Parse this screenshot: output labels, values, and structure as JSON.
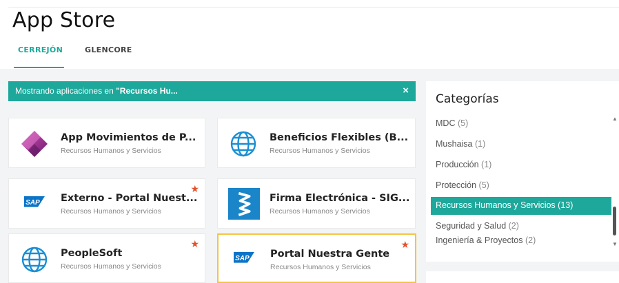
{
  "header": {
    "title": "App Store"
  },
  "tabs": [
    {
      "label": "CERREJÓN",
      "active": true
    },
    {
      "label": "GLENCORE",
      "active": false
    }
  ],
  "banner": {
    "prefix": "Mostrando aplicaciones en ",
    "filter": "\"Recursos Hu...",
    "close": "×"
  },
  "apps": [
    {
      "name": "App Movimientos de P...",
      "category": "Recursos Humanos y Servicios",
      "icon": "power-apps-icon",
      "favorite": false
    },
    {
      "name": "Beneficios Flexibles (B...",
      "category": "Recursos Humanos y Servicios",
      "icon": "globe-icon",
      "favorite": false
    },
    {
      "name": "Externo - Portal Nuest...",
      "category": "Recursos Humanos y Servicios",
      "icon": "sap-logo-icon",
      "favorite": true
    },
    {
      "name": "Firma Electrónica - SIG...",
      "category": "Recursos Humanos y Servicios",
      "icon": "signature-icon",
      "favorite": false
    },
    {
      "name": "PeopleSoft",
      "category": "Recursos Humanos y Servicios",
      "icon": "globe-icon",
      "favorite": true
    },
    {
      "name": "Portal Nuestra Gente",
      "category": "Recursos Humanos y Servicios",
      "icon": "sap-logo-icon",
      "favorite": true,
      "selected": true
    }
  ],
  "categories": {
    "title": "Categorías",
    "items": [
      {
        "label": "MDC",
        "count": "(5)"
      },
      {
        "label": "Mushaisa",
        "count": "(1)"
      },
      {
        "label": "Producción",
        "count": "(1)"
      },
      {
        "label": "Protección",
        "count": "(5)"
      },
      {
        "label": "Recursos Humanos y Servicios",
        "count": "(13)",
        "active": true
      },
      {
        "label": "Seguridad y Salud",
        "count": "(2)"
      },
      {
        "label": "Ingeniería & Proyectos",
        "count": "(2)"
      }
    ]
  },
  "colors": {
    "accent": "#1ea89b",
    "star": "#e4502b",
    "selected_border": "#f4c542",
    "sap_blue": "#0b74c8"
  }
}
